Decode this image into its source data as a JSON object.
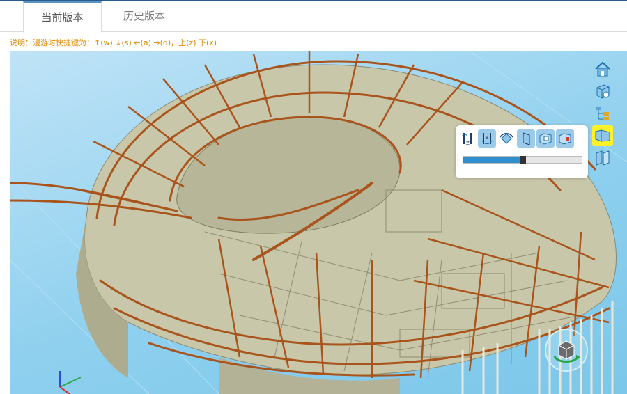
{
  "tabs": [
    {
      "label": "当前版本",
      "active": true
    },
    {
      "label": "历史版本",
      "active": false
    }
  ],
  "note": "说明：漫游时快捷键为：↑(w) ↓(s) ←(a) →(d)，上(z) 下(x)",
  "toolbar": {
    "icons": [
      "home-icon",
      "box-view-icon",
      "tree-icon",
      "roam-icon",
      "section-icon"
    ],
    "highlighted": "roam-icon"
  },
  "roam_panel": {
    "buttons": [
      "rotate-z-icon",
      "rotate-x-icon",
      "orbit-icon",
      "flag-icon",
      "camera-front-icon",
      "camera-side-icon"
    ],
    "speed": 0.5
  },
  "colors": {
    "accent": "#2f8fce",
    "highlight": "#fff22a",
    "note": "#e08a00",
    "beam": "#a9541c",
    "slab": "#c8c6a8"
  }
}
